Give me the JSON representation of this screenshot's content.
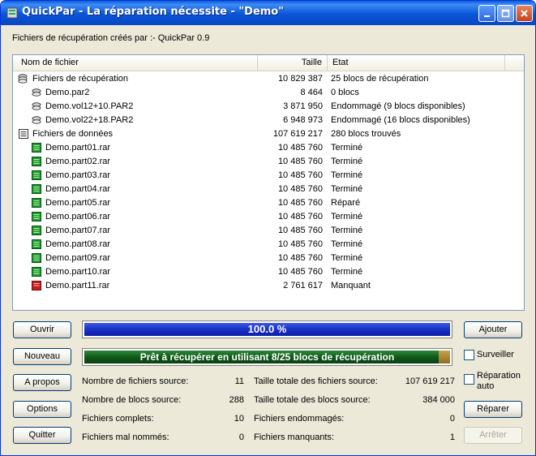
{
  "window": {
    "title": "QuickPar - La réparation nécessite - \"Demo\""
  },
  "header": {
    "created_by": "Fichiers de récupération créés par :- QuickPar 0.9"
  },
  "list": {
    "columns": {
      "name": "Nom de fichier",
      "size": "Taille",
      "state": "Etat"
    },
    "rows": [
      {
        "name": "Fichiers de récupération",
        "size": "10 829 387",
        "state": "25 blocs de récupération",
        "icon": "recovery-group-icon"
      },
      {
        "name": "Demo.par2",
        "size": "8 464",
        "state": "0 blocs",
        "icon": "par-file-icon"
      },
      {
        "name": "Demo.vol12+10.PAR2",
        "size": "3 871 950",
        "state": "Endommagé (9 blocs disponibles)",
        "icon": "par-file-icon"
      },
      {
        "name": "Demo.vol22+18.PAR2",
        "size": "6 948 973",
        "state": "Endommagé (16 blocs disponibles)",
        "icon": "par-file-icon"
      },
      {
        "name": "Fichiers de données",
        "size": "107 619 217",
        "state": "280 blocs trouvés",
        "icon": "data-group-icon"
      },
      {
        "name": "Demo.part01.rar",
        "size": "10 485 760",
        "state": "Terminé",
        "icon": "ok-file-icon"
      },
      {
        "name": "Demo.part02.rar",
        "size": "10 485 760",
        "state": "Terminé",
        "icon": "ok-file-icon"
      },
      {
        "name": "Demo.part03.rar",
        "size": "10 485 760",
        "state": "Terminé",
        "icon": "ok-file-icon"
      },
      {
        "name": "Demo.part04.rar",
        "size": "10 485 760",
        "state": "Terminé",
        "icon": "ok-file-icon"
      },
      {
        "name": "Demo.part05.rar",
        "size": "10 485 760",
        "state": "Réparé",
        "icon": "ok-file-icon"
      },
      {
        "name": "Demo.part06.rar",
        "size": "10 485 760",
        "state": "Terminé",
        "icon": "ok-file-icon"
      },
      {
        "name": "Demo.part07.rar",
        "size": "10 485 760",
        "state": "Terminé",
        "icon": "ok-file-icon"
      },
      {
        "name": "Demo.part08.rar",
        "size": "10 485 760",
        "state": "Terminé",
        "icon": "ok-file-icon"
      },
      {
        "name": "Demo.part09.rar",
        "size": "10 485 760",
        "state": "Terminé",
        "icon": "ok-file-icon"
      },
      {
        "name": "Demo.part10.rar",
        "size": "10 485 760",
        "state": "Terminé",
        "icon": "ok-file-icon"
      },
      {
        "name": "Demo.part11.rar",
        "size": "2 761 617",
        "state": "Manquant",
        "icon": "missing-file-icon"
      }
    ]
  },
  "buttons": {
    "open": "Ouvrir",
    "new": "Nouveau",
    "about": "A propos",
    "options": "Options",
    "quit": "Quitter",
    "add": "Ajouter",
    "repair": "Réparer",
    "stop": "Arrêter"
  },
  "checkboxes": {
    "watch": "Surveiller",
    "auto_repair_line1": "Réparation",
    "auto_repair_line2": "auto"
  },
  "progress": {
    "text": "100.0 %",
    "fraction": 1.0
  },
  "status": {
    "text": "Prêt à récupérer en utilisant 8/25 blocs de récupération",
    "used": 8,
    "total": 25
  },
  "stats": {
    "source_files_label": "Nombre de fichiers source:",
    "source_files": "11",
    "source_blocks_label": "Nombre de blocs source:",
    "source_blocks": "288",
    "complete_files_label": "Fichiers complets:",
    "complete_files": "10",
    "misnamed_files_label": "Fichiers mal nommés:",
    "misnamed_files": "0",
    "total_source_size_label": "Taille totale des fichiers source:",
    "total_source_size": "107 619 217",
    "total_block_size_label": "Taille totale des blocs source:",
    "total_block_size": "384 000",
    "damaged_files_label": "Fichiers endommagés:",
    "damaged_files": "0",
    "missing_files_label": "Fichiers manquants:",
    "missing_files": "1"
  },
  "colors": {
    "progress_blue": "#1a2fc6",
    "status_green": "#0f5a1a",
    "status_gold": "#b08a33",
    "missing_red": "#c81e1e",
    "ok_green": "#1e9b2a"
  }
}
